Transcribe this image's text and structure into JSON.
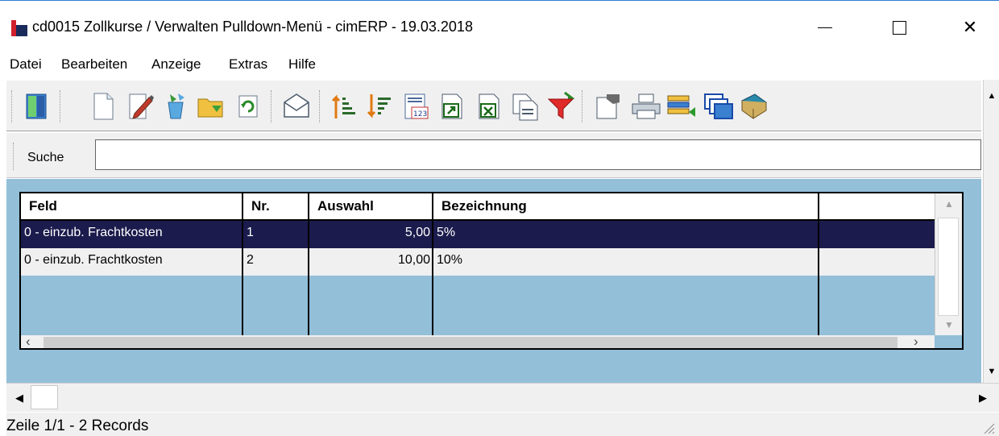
{
  "window": {
    "title": "cd0015 Zollkurse / Verwalten Pulldown-Menü - cimERP - 19.03.2018",
    "close_glyph": "✕"
  },
  "menu": {
    "items": [
      "Datei",
      "Bearbeiten",
      "Anzeige",
      "Extras",
      "Hilfe"
    ]
  },
  "toolbar": {
    "icons": [
      "exit-door-icon",
      "new-document-icon",
      "edit-pencil-icon",
      "recycle-icon",
      "open-folder-icon",
      "refresh-icon",
      "mail-envelope-icon",
      "sort-ascending-icon",
      "sort-descending-icon",
      "calendar-123-icon",
      "export-icon",
      "excel-export-icon",
      "copy-documents-icon",
      "filter-funnel-icon",
      "document-hand-icon",
      "printer-icon",
      "columns-icon",
      "windows-icon",
      "book-icon"
    ]
  },
  "search": {
    "label": "Suche",
    "value": ""
  },
  "grid": {
    "columns": [
      "Feld",
      "Nr.",
      "Auswahl",
      "Bezeichnung",
      ""
    ],
    "rows": [
      {
        "feld": "0 - einzub. Frachtkosten",
        "nr": "1",
        "auswahl": "5,00",
        "bezeichnung": "5%",
        "selected": true
      },
      {
        "feld": "0 - einzub. Frachtkosten",
        "nr": "2",
        "auswahl": "10,00",
        "bezeichnung": "10%",
        "selected": false
      }
    ]
  },
  "status": {
    "text": "Zeile 1/1 - 2 Records"
  },
  "colors": {
    "selected_row": "#1b1b4d",
    "content_bg": "#93bfd9",
    "brand_red": "#d0202b"
  }
}
